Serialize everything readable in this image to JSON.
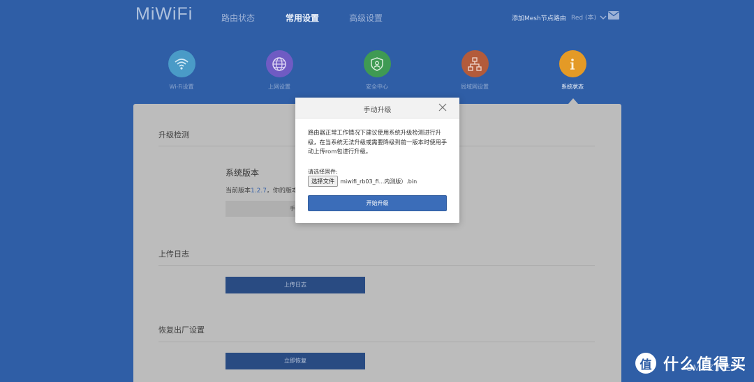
{
  "header": {
    "logo": "MiWiFi",
    "nav": [
      {
        "label": "路由状态",
        "active": false
      },
      {
        "label": "常用设置",
        "active": true
      },
      {
        "label": "高级设置",
        "active": false
      }
    ],
    "mesh_link": "添加Mesh节点路由",
    "user_name": "Red (本)",
    "mail_icon": "mail-icon"
  },
  "categories": [
    {
      "label": "Wi-Fi设置",
      "icon": "wifi-icon",
      "color": "#4a9bc7"
    },
    {
      "label": "上网设置",
      "icon": "globe-icon",
      "color": "#6f5bc3"
    },
    {
      "label": "安全中心",
      "icon": "shield-icon",
      "color": "#3f9a53"
    },
    {
      "label": "局域网设置",
      "icon": "network-icon",
      "color": "#b35b3b"
    },
    {
      "label": "系统状态",
      "icon": "info-icon",
      "color": "#e49a26",
      "active": true
    }
  ],
  "panel": {
    "upgrade_title": "升级检测",
    "system_version_title": "系统版本",
    "current_version_prefix": "当前版本",
    "current_version": "1.2.7",
    "current_version_suffix": "，你的版本是",
    "manual_button_partial": "手动",
    "upload_log_title": "上传日志",
    "upload_log_button": "上传日志",
    "reset_title": "恢复出厂设置",
    "reset_button": "立即恢复"
  },
  "modal": {
    "title": "手动升级",
    "description": "路由器正常工作情况下建议使用系统升级检测进行升级，在当系统无法升级或需要降级到前一版本时使用手动上传rom包进行升级。",
    "file_label": "请选择固件:",
    "file_button": "选择文件",
    "file_name": "miwifi_rb03_fi...内测版）.bin",
    "start_button": "开始升级"
  },
  "watermark": {
    "badge": "值",
    "text": "什么值得买",
    "sub": "SMYZ.NET"
  },
  "colors": {
    "background": "#2f5ea6",
    "panel": "#bcbcbc",
    "primary_button": "#3b6db9",
    "dark_button": "#294b82"
  }
}
